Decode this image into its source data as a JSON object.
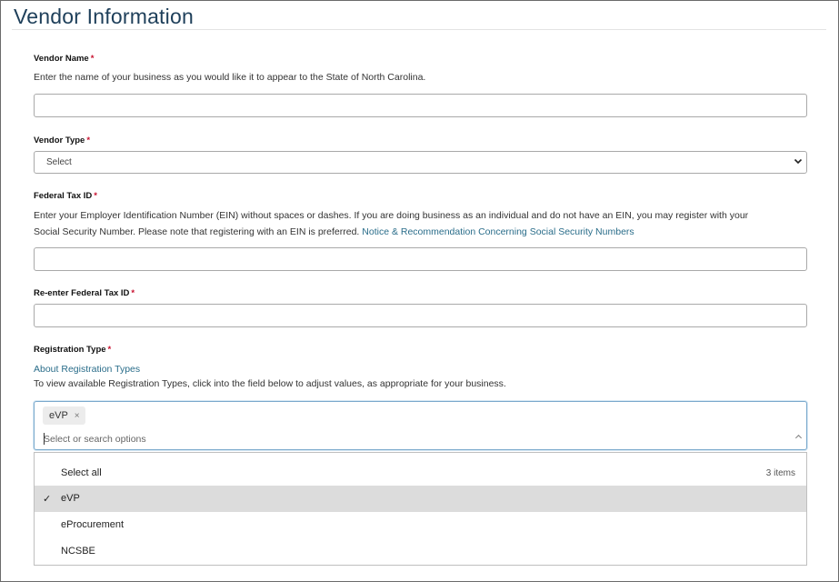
{
  "page": {
    "title": "Vendor Information"
  },
  "required_marker": "*",
  "vendor_name": {
    "label": "Vendor Name",
    "help": "Enter the name of your business as you would like it to appear to the State of North Carolina.",
    "value": ""
  },
  "vendor_type": {
    "label": "Vendor Type",
    "selected": "Select",
    "chevron": "⌄"
  },
  "federal_tax_id": {
    "label": "Federal Tax ID",
    "help_line1": "Enter your Employer Identification Number (EIN) without spaces or dashes. If you are doing business as an individual and do not have an EIN, you may register with your",
    "help_line2": "Social Security Number. Please note that registering with an EIN is preferred.",
    "link": "Notice & Recommendation Concerning Social Security Numbers",
    "value": ""
  },
  "reenter_tax_id": {
    "label": "Re-enter Federal Tax ID",
    "value": ""
  },
  "registration_type": {
    "label": "Registration Type",
    "about_link": "About Registration Types",
    "help": "To view available Registration Types, click into the field below to adjust values, as appropriate for your business.",
    "chips": [
      {
        "label": "eVP",
        "remove": "×"
      }
    ],
    "placeholder": "Select or search options",
    "chevron": "^",
    "dropdown": {
      "select_all": "Select all",
      "count": "3 items",
      "options": [
        {
          "label": "eVP",
          "selected": true,
          "check": "✓"
        },
        {
          "label": "eProcurement",
          "selected": false
        },
        {
          "label": "NCSBE",
          "selected": false
        }
      ]
    }
  }
}
